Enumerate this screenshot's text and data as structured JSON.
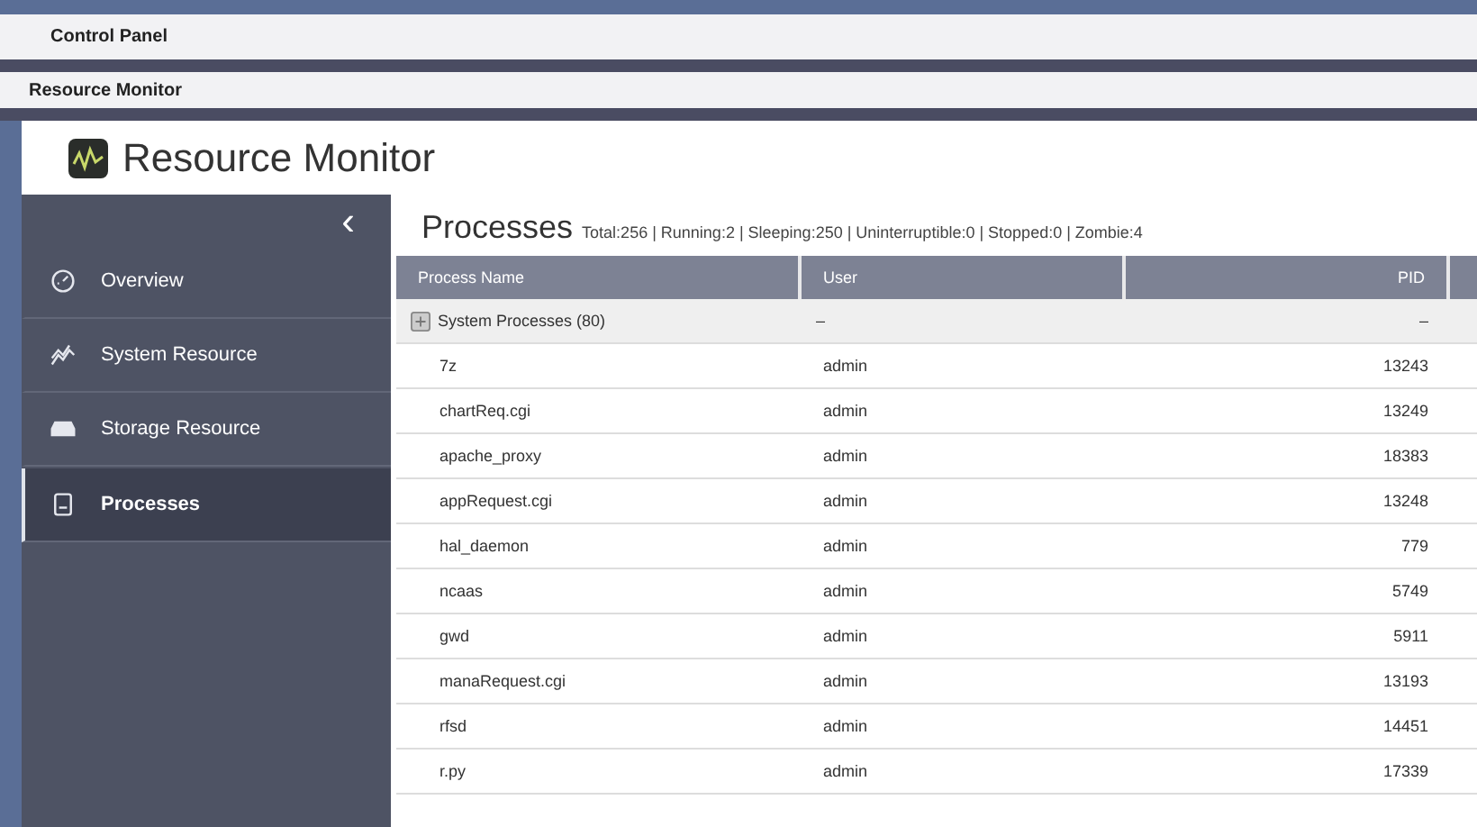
{
  "control_panel": {
    "title": "Control Panel"
  },
  "window": {
    "title": "Resource Monitor"
  },
  "app": {
    "title": "Resource Monitor"
  },
  "sidebar": {
    "collapse": "‹",
    "items": [
      {
        "label": "Overview",
        "selected": false
      },
      {
        "label": "System Resource",
        "selected": false
      },
      {
        "label": "Storage Resource",
        "selected": false
      },
      {
        "label": "Processes",
        "selected": true
      }
    ]
  },
  "processes": {
    "title": "Processes",
    "summary": "Total:256 | Running:2 | Sleeping:250 | Uninterruptible:0 | Stopped:0 | Zombie:4",
    "columns": [
      "Process Name",
      "User",
      "PID"
    ],
    "group": {
      "name": "System Processes (80)",
      "user": "–",
      "pid": "–"
    },
    "rows": [
      {
        "name": "7z",
        "user": "admin",
        "pid": "13243"
      },
      {
        "name": "chartReq.cgi",
        "user": "admin",
        "pid": "13249"
      },
      {
        "name": "apache_proxy",
        "user": "admin",
        "pid": "18383"
      },
      {
        "name": "appRequest.cgi",
        "user": "admin",
        "pid": "13248"
      },
      {
        "name": "hal_daemon",
        "user": "admin",
        "pid": "779"
      },
      {
        "name": "ncaas",
        "user": "admin",
        "pid": "5749"
      },
      {
        "name": "gwd",
        "user": "admin",
        "pid": "5911"
      },
      {
        "name": "manaRequest.cgi",
        "user": "admin",
        "pid": "13193"
      },
      {
        "name": "rfsd",
        "user": "admin",
        "pid": "14451"
      },
      {
        "name": "r.py",
        "user": "admin",
        "pid": "17339"
      }
    ]
  }
}
